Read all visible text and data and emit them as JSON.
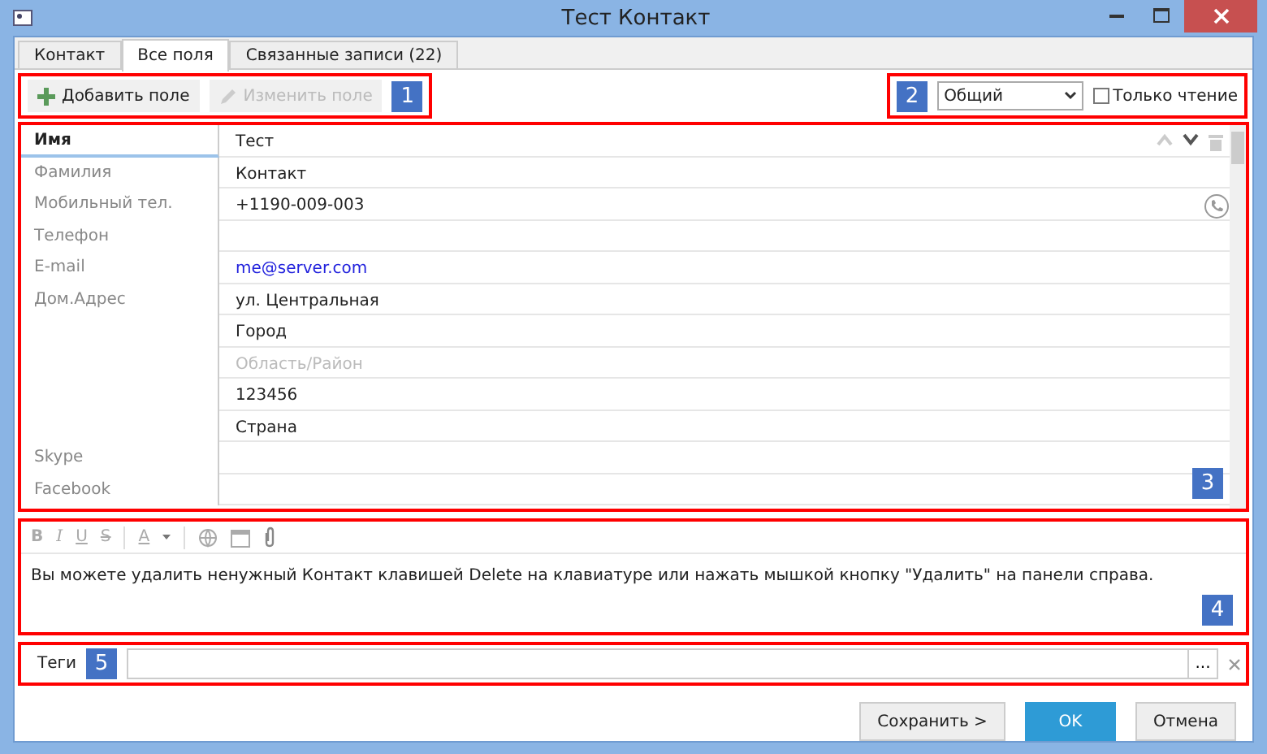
{
  "window": {
    "title": "Тест Контакт"
  },
  "tabs": [
    {
      "label": "Контакт",
      "selected": false
    },
    {
      "label": "Все поля",
      "selected": true
    },
    {
      "label": "Связанные записи  (22)",
      "selected": false
    }
  ],
  "toolbar": {
    "buttons": [
      {
        "label": "Добавить поле",
        "kind": "add",
        "disabled": false
      },
      {
        "label": "Изменить поле",
        "kind": "edit",
        "disabled": true
      }
    ],
    "badge": "1"
  },
  "view": {
    "badge": "2",
    "dropdown": "Общий",
    "read_only": {
      "label": "Только чтение",
      "checked": false
    }
  },
  "fields": {
    "badge": "3",
    "rows": [
      {
        "label": "Имя",
        "value": "Тест",
        "kind": "text",
        "selected": true
      },
      {
        "label": "Фамилия",
        "value": "Контакт",
        "kind": "text",
        "selected": false
      },
      {
        "label": "Мобильный тел.",
        "value": "+1190-009-003",
        "kind": "phone",
        "selected": false
      },
      {
        "label": "Телефон",
        "kind": "text",
        "selected": false
      },
      {
        "label": "E-mail",
        "value": "me@server.com",
        "kind": "link",
        "selected": false
      },
      {
        "label": "Дом.Адрес",
        "value": "ул. Центральная",
        "kind": "text",
        "selected": false
      },
      {
        "value": "Город",
        "kind": "text",
        "selected": false
      },
      {
        "placeholder": "Область/Район",
        "kind": "text",
        "selected": false
      },
      {
        "value": "123456",
        "kind": "text",
        "selected": false
      },
      {
        "value": "Страна",
        "kind": "text",
        "selected": false
      },
      {
        "label": "Skype",
        "kind": "text",
        "selected": false
      },
      {
        "label": "Facebook",
        "kind": "text",
        "selected": false
      }
    ]
  },
  "note": {
    "badge": "4",
    "format_buttons": [
      {
        "label": "B",
        "kind": "bold"
      },
      {
        "label": "I",
        "kind": "italic"
      },
      {
        "label": "U",
        "kind": "underline"
      },
      {
        "label": "S",
        "kind": "strike"
      },
      {
        "label": "A",
        "kind": "color"
      }
    ],
    "text": "Вы можете удалить ненужный Контакт клавишей Delete на клавиатуре или нажать мышкой кнопку \"Удалить\" на панели справа."
  },
  "tags": {
    "label": "Теги",
    "badge": "5",
    "more": "..."
  },
  "buttons": [
    {
      "label": "Сохранить >",
      "primary": false
    },
    {
      "label": "OK",
      "primary": true
    },
    {
      "label": "Отмена",
      "primary": false
    }
  ]
}
